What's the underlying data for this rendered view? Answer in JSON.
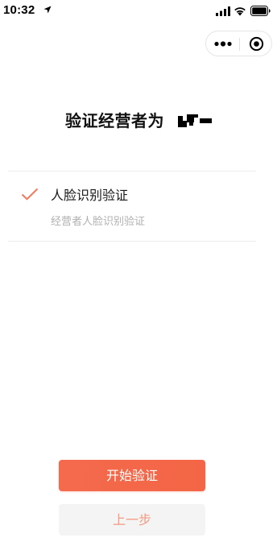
{
  "status_bar": {
    "time": "10:32",
    "icons": [
      "location-arrow-icon",
      "signal-bars-icon",
      "wifi-icon",
      "battery-icon"
    ]
  },
  "capsule": {
    "icons": [
      "more-dots-icon",
      "close-target-icon"
    ]
  },
  "title": {
    "text": "验证经营者为"
  },
  "option": {
    "selected": true,
    "title": "人脸识别验证",
    "subtitle": "经营者人脸识别验证"
  },
  "buttons": {
    "primary_label": "开始验证",
    "secondary_label": "上一步"
  },
  "colors": {
    "accent": "#f36545",
    "check": "#f27b5b",
    "secondary_text": "#f39a80",
    "muted_text": "#b0b0b0",
    "divider": "#ededed"
  }
}
